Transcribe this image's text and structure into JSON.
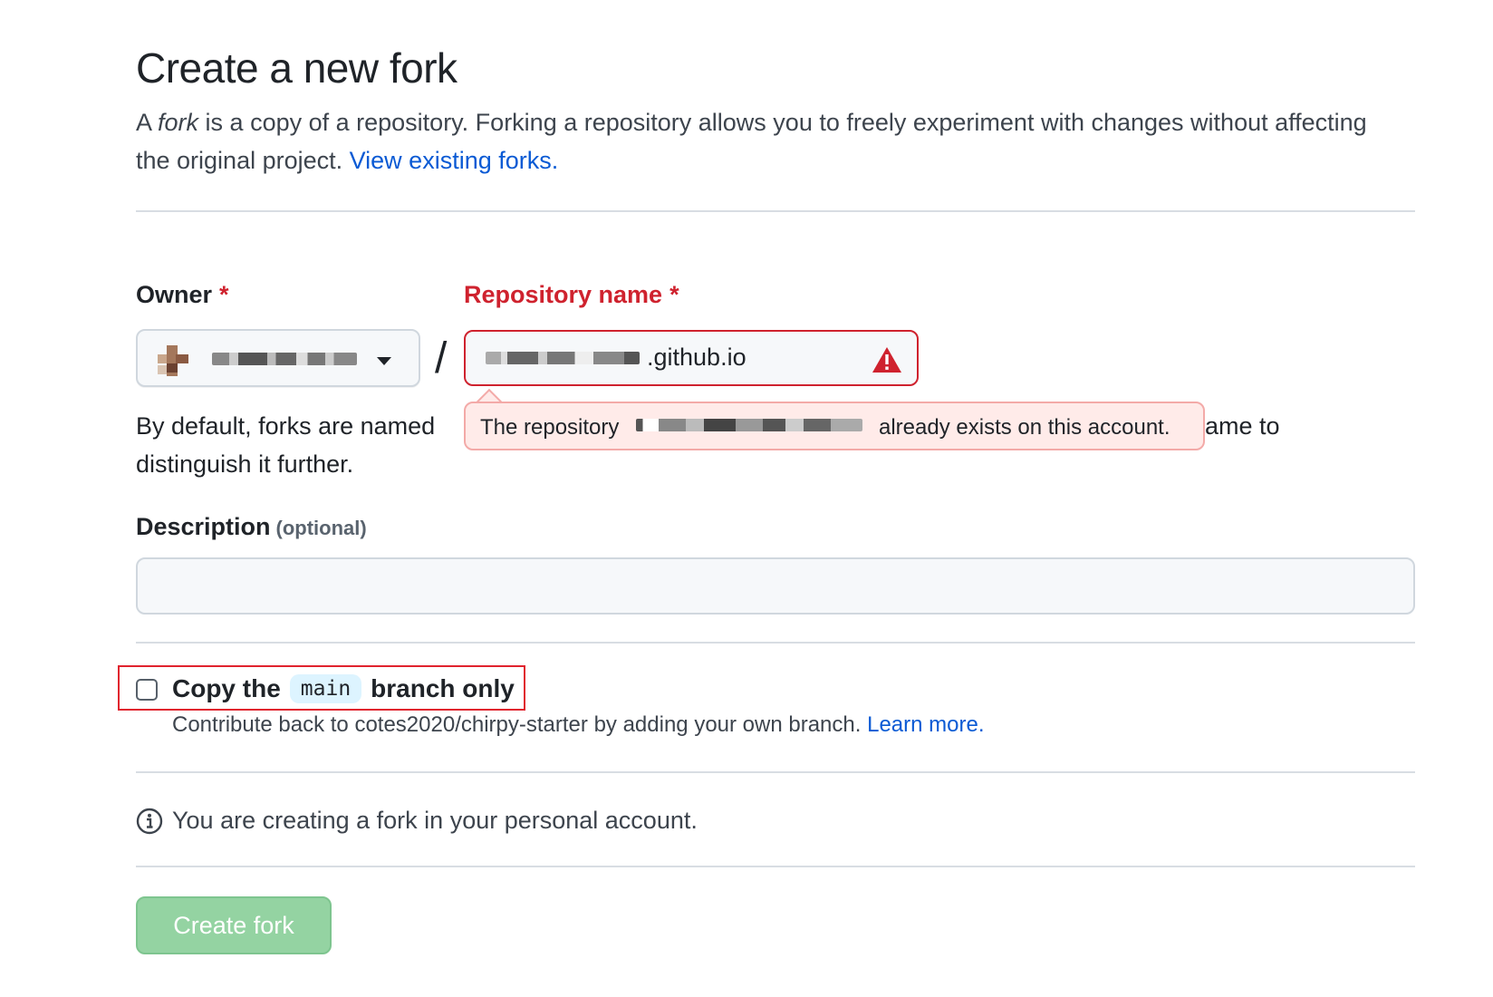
{
  "header": {
    "title": "Create a new fork",
    "intro_prefix": "A ",
    "intro_fork_word": "fork",
    "intro_rest": " is a copy of a repository. Forking a repository allows you to freely experiment with changes without affecting the original project. ",
    "view_forks_link": "View existing forks."
  },
  "owner": {
    "label": "Owner",
    "required_mark": "*",
    "selected_value": "(redacted)"
  },
  "separator": "/",
  "repository": {
    "label": "Repository name",
    "required_mark": "*",
    "value_suffix": ".github.io",
    "error_state": true,
    "error_icon": "alert-triangle-icon",
    "error_color": "#cf222e"
  },
  "tooltip": {
    "part1": "The repository",
    "part2": "already exists on this account."
  },
  "helper": {
    "visible_text": "By default, forks are named",
    "visible_text_tail": "ame to",
    "second_line": "distinguish it further."
  },
  "description": {
    "label": "Description",
    "optional": "(optional)",
    "value": "",
    "placeholder": ""
  },
  "copy_branch": {
    "label_before": "Copy the",
    "branch": "main",
    "label_after": "branch only",
    "checked": false,
    "help_text": "Contribute back to cotes2020/chirpy-starter by adding your own branch.",
    "learn_more": "Learn more."
  },
  "info": {
    "icon": "info-icon",
    "text": "You are creating a fork in your personal account."
  },
  "submit": {
    "label": "Create fork",
    "disabled": true,
    "color": "#94d3a2"
  }
}
